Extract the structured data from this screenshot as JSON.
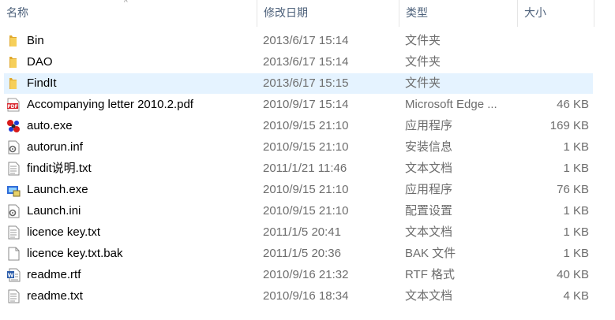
{
  "columns": {
    "name": "名称",
    "modified": "修改日期",
    "type": "类型",
    "size": "大小"
  },
  "files": [
    {
      "name": "Bin",
      "modified": "2013/6/17 15:14",
      "type": "文件夹",
      "size": "",
      "icon": "folder-icon",
      "selected": false
    },
    {
      "name": "DAO",
      "modified": "2013/6/17 15:14",
      "type": "文件夹",
      "size": "",
      "icon": "folder-icon",
      "selected": false
    },
    {
      "name": "FindIt",
      "modified": "2013/6/17 15:15",
      "type": "文件夹",
      "size": "",
      "icon": "folder-icon",
      "selected": true
    },
    {
      "name": "Accompanying letter 2010.2.pdf",
      "modified": "2010/9/17 15:14",
      "type": "Microsoft Edge ...",
      "size": "46 KB",
      "icon": "pdf-icon",
      "selected": false
    },
    {
      "name": "auto.exe",
      "modified": "2010/9/15 21:10",
      "type": "应用程序",
      "size": "169 KB",
      "icon": "app-molecule-icon",
      "selected": false
    },
    {
      "name": "autorun.inf",
      "modified": "2010/9/15 21:10",
      "type": "安装信息",
      "size": "1 KB",
      "icon": "settings-file-icon",
      "selected": false
    },
    {
      "name": "findit说明.txt",
      "modified": "2011/1/21 11:46",
      "type": "文本文档",
      "size": "1 KB",
      "icon": "text-file-icon",
      "selected": false
    },
    {
      "name": "Launch.exe",
      "modified": "2010/9/15 21:10",
      "type": "应用程序",
      "size": "76 KB",
      "icon": "installer-icon",
      "selected": false
    },
    {
      "name": "Launch.ini",
      "modified": "2010/9/15 21:10",
      "type": "配置设置",
      "size": "1 KB",
      "icon": "settings-file-icon",
      "selected": false
    },
    {
      "name": "licence key.txt",
      "modified": "2011/1/5 20:41",
      "type": "文本文档",
      "size": "1 KB",
      "icon": "text-file-icon",
      "selected": false
    },
    {
      "name": "licence key.txt.bak",
      "modified": "2011/1/5 20:36",
      "type": "BAK 文件",
      "size": "1 KB",
      "icon": "blank-file-icon",
      "selected": false
    },
    {
      "name": "readme.rtf",
      "modified": "2010/9/16 21:32",
      "type": "RTF 格式",
      "size": "40 KB",
      "icon": "word-doc-icon",
      "selected": false
    },
    {
      "name": "readme.txt",
      "modified": "2010/9/16 18:34",
      "type": "文本文档",
      "size": "4 KB",
      "icon": "text-file-icon",
      "selected": false
    }
  ],
  "colors": {
    "selected_row": "#e5f3ff",
    "header_text": "#4c607a",
    "folder": "#f0c14b"
  }
}
